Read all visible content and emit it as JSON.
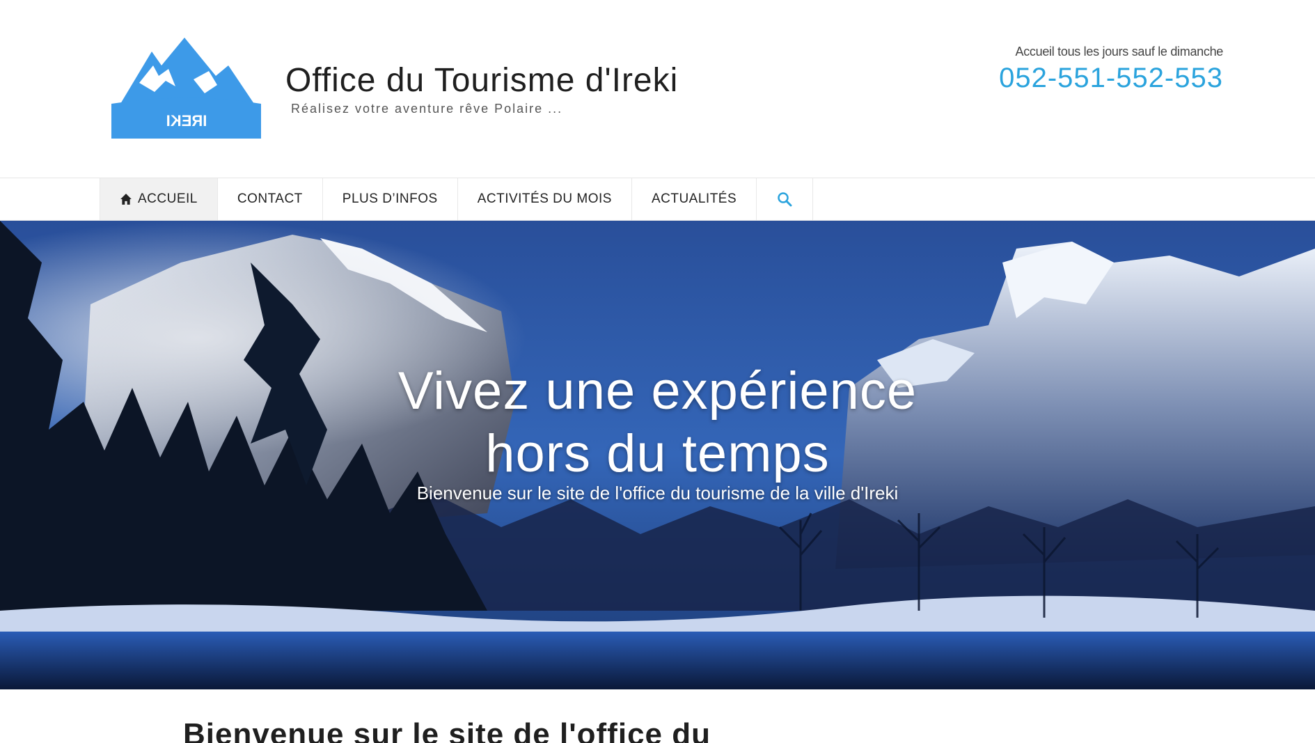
{
  "header": {
    "site_title": "Office du Tourisme d'Ireki",
    "tagline": "Réalisez votre aventure rêve Polaire ...",
    "logo_text": "IREKI",
    "hours": "Accueil tous les jours sauf le dimanche",
    "phone": "052-551-552-553"
  },
  "nav": {
    "items": [
      {
        "label": "ACCUEIL",
        "icon": "home-icon",
        "active": true
      },
      {
        "label": "CONTACT"
      },
      {
        "label": "PLUS D’INFOS"
      },
      {
        "label": "ACTIVITÉS DU MOIS"
      },
      {
        "label": "ACTUALITÉS"
      }
    ],
    "search_icon": "search-icon"
  },
  "hero": {
    "title_line1": "Vivez une expérience",
    "title_line2": "hors du temps",
    "subtitle": "Bienvenue sur le site de l'office du tourisme de la ville d'Ireki"
  },
  "main": {
    "heading": "Bienvenue sur le site de l'office du"
  },
  "colors": {
    "accent": "#2aa3dd",
    "logo_blue": "#3d9ae8"
  }
}
